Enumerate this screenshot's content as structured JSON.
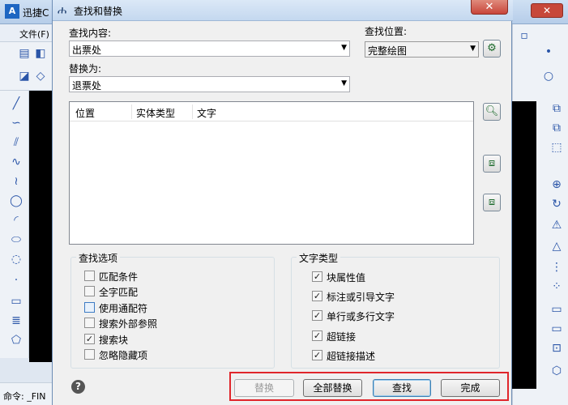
{
  "app": {
    "title": "迅捷C",
    "logo_text": "A",
    "menu_file": "文件(F)",
    "command_prefix": "命令: _FIN"
  },
  "dialog": {
    "title": "查找和替换",
    "find_label": "查找内容:",
    "find_value": "出票处",
    "replace_label": "替换为:",
    "replace_value": "退票处",
    "search_location_label": "查找位置:",
    "search_location_value": "完整绘图",
    "results_columns": [
      "位置",
      "实体类型",
      "文字"
    ],
    "find_options": {
      "title": "查找选项",
      "items": [
        {
          "label": "匹配条件",
          "checked": false
        },
        {
          "label": "全字匹配",
          "checked": false
        },
        {
          "label": "使用通配符",
          "checked": false
        },
        {
          "label": "搜索外部参照",
          "checked": false
        },
        {
          "label": "搜索块",
          "checked": true
        },
        {
          "label": "忽略隐藏项",
          "checked": false
        }
      ]
    },
    "text_types": {
      "title": "文字类型",
      "items": [
        {
          "label": "块属性值",
          "checked": true
        },
        {
          "label": "标注或引导文字",
          "checked": true
        },
        {
          "label": "单行或多行文字",
          "checked": true
        },
        {
          "label": "超链接",
          "checked": true
        },
        {
          "label": "超链接描述",
          "checked": true
        }
      ]
    },
    "buttons": {
      "replace": "替换",
      "replace_all": "全部替换",
      "find": "查找",
      "done": "完成"
    },
    "help_symbol": "?"
  },
  "colors": {
    "highlight": "#e0262b",
    "title_bar": "#c4d8ef"
  }
}
